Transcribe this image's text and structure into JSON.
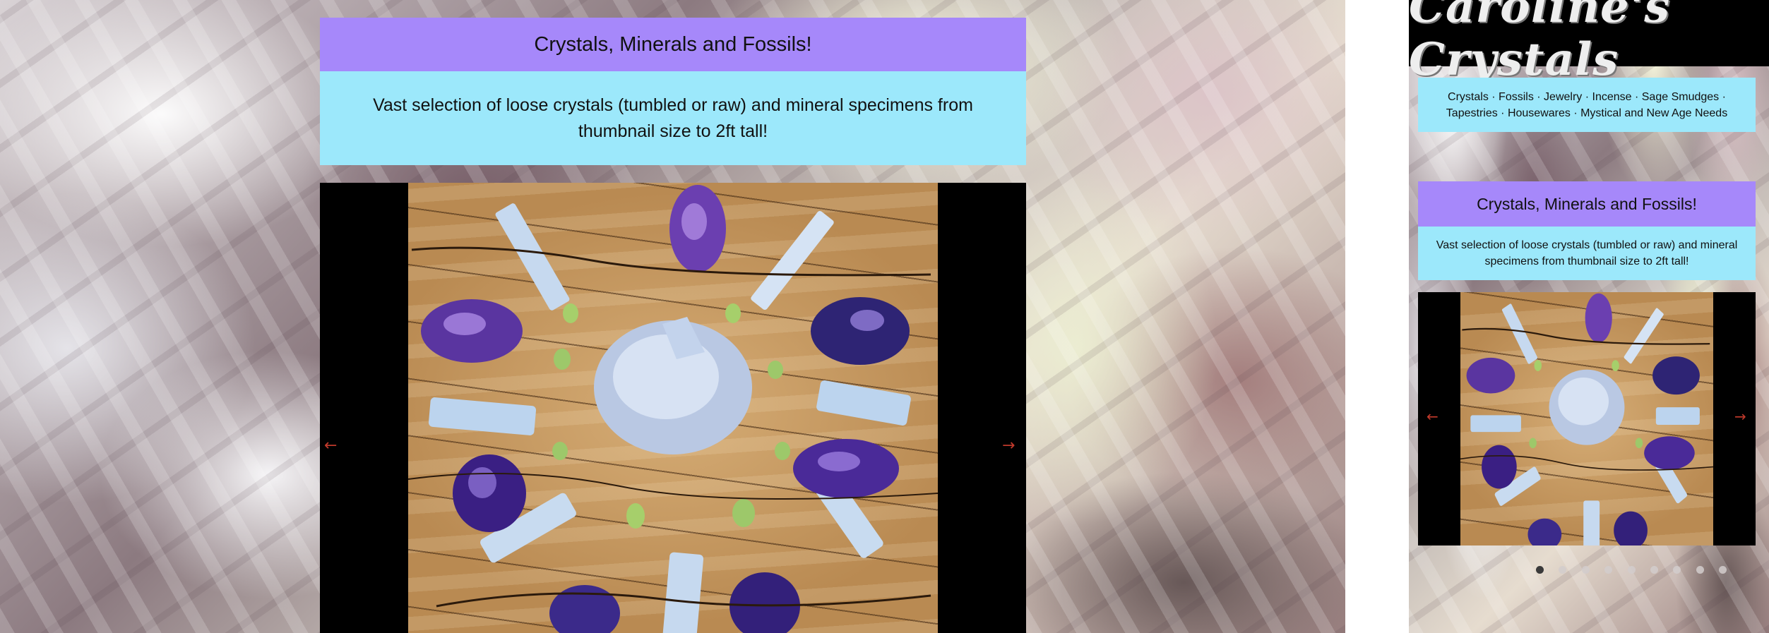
{
  "desktop": {
    "heading": "Crystals, Minerals and Fossils!",
    "description": "Vast selection of loose crystals (tumbled or raw) and mineral specimens from thumbnail size to 2ft tall!",
    "prev_arrow": "←",
    "next_arrow": "→"
  },
  "mobile": {
    "logo": "Caroline's Crystals",
    "tagline": "Crystals · Fossils · Jewelry · Incense · Sage Smudges · Tapestries · Housewares · Mystical and New Age Needs",
    "heading": "Crystals, Minerals and Fossils!",
    "description": "Vast selection of loose crystals (tumbled or raw) and mineral specimens from thumbnail size to 2ft tall!",
    "prev_arrow": "←",
    "next_arrow": "→",
    "slide_count": 9,
    "active_slide": 1
  },
  "colors": {
    "heading_bg": "#a688fa",
    "description_bg": "#9ce8fb",
    "arrow": "#c0392b",
    "slideshow_bg": "#000000"
  }
}
